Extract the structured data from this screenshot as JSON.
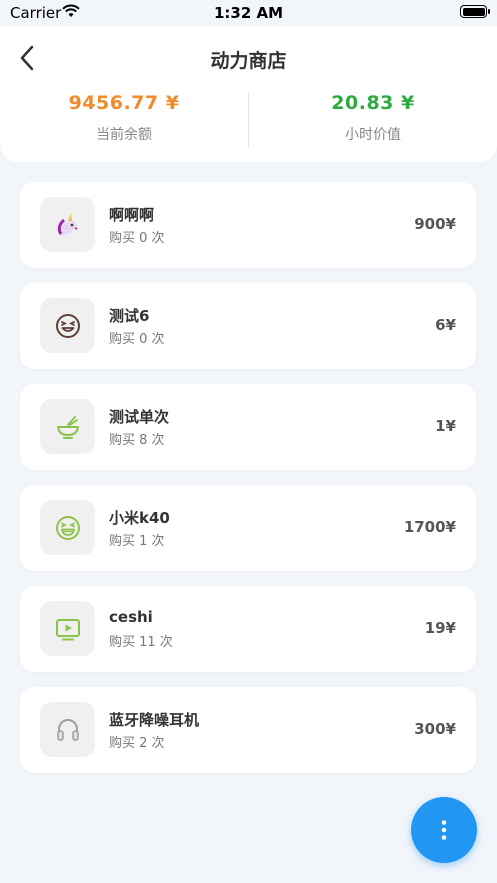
{
  "status_bar": {
    "carrier": "Carrier",
    "time": "1:32 AM"
  },
  "header": {
    "title": "动力商店",
    "balance": {
      "value": "9456.77 ¥",
      "label": "当前余额"
    },
    "hourly_value": {
      "value": "20.83 ¥",
      "label": "小时价值"
    }
  },
  "items": [
    {
      "name": "啊啊啊",
      "count": "购买 0 次",
      "price": "900¥",
      "icon": "unicorn-icon"
    },
    {
      "name": "测试6",
      "count": "购买 0 次",
      "price": "6¥",
      "icon": "laughing-face-icon"
    },
    {
      "name": "测试单次",
      "count": "购买 8 次",
      "price": "1¥",
      "icon": "noodle-bowl-icon"
    },
    {
      "name": "小米k40",
      "count": "购买 1 次",
      "price": "1700¥",
      "icon": "grinning-squint-face-icon"
    },
    {
      "name": "ceshi",
      "count": "购买 11 次",
      "price": "19¥",
      "icon": "tv-play-icon"
    },
    {
      "name": "蓝牙降噪耳机",
      "count": "购买 2 次",
      "price": "300¥",
      "icon": "headphones-icon"
    }
  ],
  "colors": {
    "balance": "#f28b2b",
    "hourly": "#2eaa3f",
    "fab": "#2196f3",
    "icon_green": "#8bc34a"
  },
  "fab": {
    "icon": "more-vertical-icon"
  }
}
